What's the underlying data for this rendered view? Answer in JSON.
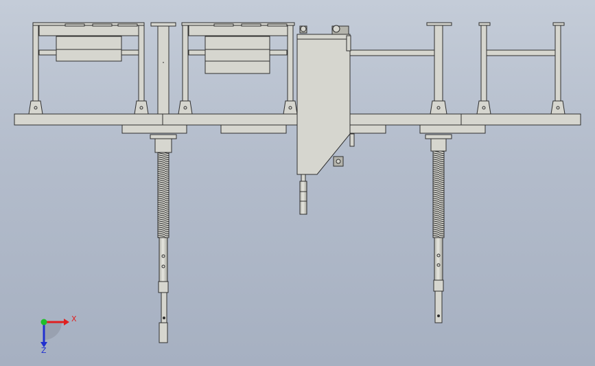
{
  "colors": {
    "background_top": "#c4ccd8",
    "background_bottom": "#a6b0c1",
    "part_fill": "#d6d6cf",
    "part_shade": "#b4b4ac",
    "part_dark": "#8f8f88",
    "edge": "#2e2e2e",
    "axis_x": "#e01f1f",
    "axis_y": "#1fbf2a",
    "axis_z": "#2030d0"
  },
  "triad": {
    "x_label": "X",
    "z_label": "Z",
    "icon": "coordinate-triad-icon"
  }
}
